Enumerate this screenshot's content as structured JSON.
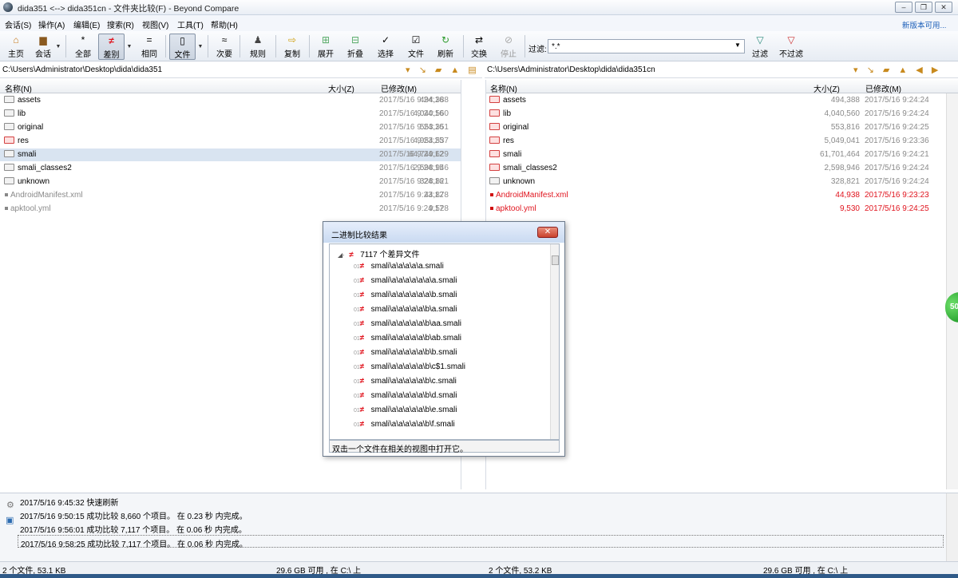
{
  "window": {
    "title": "dida351 <--> dida351cn - 文件夹比较(F) - Beyond Compare",
    "controls": [
      "–",
      "❐",
      "✕"
    ]
  },
  "menu": {
    "items": [
      "会话(S)",
      "操作(A)",
      "编辑(E)",
      "搜索(R)",
      "视图(V)",
      "工具(T)",
      "帮助(H)"
    ],
    "new_version": "新版本可用..."
  },
  "toolbar": {
    "home": "主页",
    "session": "会话",
    "all": "全部",
    "diffs": "差别",
    "same": "相同",
    "files": "文件",
    "minor": "次要",
    "rules": "规则",
    "copy": "复制",
    "expand": "展开",
    "collapse": "折叠",
    "select": "选择",
    "files2": "文件",
    "refresh": "刷新",
    "swap": "交换",
    "stop": "停止",
    "filter_label": "过滤:",
    "filter_value": "*.*",
    "filters": "过滤",
    "no_filters": "不过滤"
  },
  "left": {
    "path": "C:\\Users\\Administrator\\Desktop\\dida\\dida351",
    "headers": {
      "name": "名称(N)",
      "size": "大小(Z)",
      "modified": "已修改(M)"
    },
    "rows": [
      {
        "name": "assets",
        "size": "494,388",
        "date": "2017/5/16 9:24:16"
      },
      {
        "name": "lib",
        "size": "4,040,560",
        "date": "2017/5/16 9:24:16"
      },
      {
        "name": "original",
        "size": "553,351",
        "date": "2017/5/16 9:24:16"
      },
      {
        "name": "res",
        "size": "4,954,537",
        "date": "2017/5/16 9:23:25"
      },
      {
        "name": "smali",
        "size": "64,749,629",
        "date": "2017/5/16 9:24:12"
      },
      {
        "name": "smali_classes2",
        "size": "2,598,946",
        "date": "2017/5/16 9:24:15"
      },
      {
        "name": "unknown",
        "size": "328,821",
        "date": "2017/5/16 9:24:16"
      },
      {
        "name": "AndroidManifest.xml",
        "size": "44,878",
        "date": "2017/5/16 9:23:12"
      },
      {
        "name": "apktool.yml",
        "size": "9,528",
        "date": "2017/5/16 9:24:17"
      }
    ]
  },
  "right": {
    "path": "C:\\Users\\Administrator\\Desktop\\dida\\dida351cn",
    "headers": {
      "name": "名称(N)",
      "size": "大小(Z)",
      "modified": "已修改(M)"
    },
    "rows": [
      {
        "name": "assets",
        "size": "494,388",
        "date": "2017/5/16 9:24:24"
      },
      {
        "name": "lib",
        "size": "4,040,560",
        "date": "2017/5/16 9:24:24"
      },
      {
        "name": "original",
        "size": "553,816",
        "date": "2017/5/16 9:24:25"
      },
      {
        "name": "res",
        "size": "5,049,041",
        "date": "2017/5/16 9:23:36"
      },
      {
        "name": "smali",
        "size": "61,701,464",
        "date": "2017/5/16 9:24:21"
      },
      {
        "name": "smali_classes2",
        "size": "2,598,946",
        "date": "2017/5/16 9:24:24"
      },
      {
        "name": "unknown",
        "size": "328,821",
        "date": "2017/5/16 9:24:24"
      },
      {
        "name": "AndroidManifest.xml",
        "size": "44,938",
        "date": "2017/5/16 9:23:23"
      },
      {
        "name": "apktool.yml",
        "size": "9,530",
        "date": "2017/5/16 9:24:25"
      }
    ]
  },
  "dialog": {
    "title": "二进制比较结果",
    "root": "7117 个差异文件",
    "items": [
      "smali\\a\\a\\a\\a\\a.smali",
      "smali\\a\\a\\a\\a\\a\\a\\a.smali",
      "smali\\a\\a\\a\\a\\a\\a\\b.smali",
      "smali\\a\\a\\a\\a\\a\\b\\a.smali",
      "smali\\a\\a\\a\\a\\a\\b\\aa.smali",
      "smali\\a\\a\\a\\a\\a\\b\\ab.smali",
      "smali\\a\\a\\a\\a\\a\\b\\b.smali",
      "smali\\a\\a\\a\\a\\a\\b\\c$1.smali",
      "smali\\a\\a\\a\\a\\a\\b\\c.smali",
      "smali\\a\\a\\a\\a\\a\\b\\d.smali",
      "smali\\a\\a\\a\\a\\a\\b\\e.smali",
      "smali\\a\\a\\a\\a\\a\\b\\f.smali"
    ],
    "status": "双击一个文件在相关的视图中打开它。"
  },
  "log": [
    "2017/5/16 9:45:32  快速刷新",
    "2017/5/16 9:50:15  成功比较 8,660 个项目。  在 0.23 秒 内完成。",
    "2017/5/16 9:56:01  成功比较 7,117 个项目。  在 0.06 秒 内完成。",
    "2017/5/16 9:58:25  成功比较 7,117 个项目。  在 0.06 秒 内完成。"
  ],
  "status": {
    "left_files": "2 个文件, 53.1 KB",
    "left_space": "29.6 GB 可用 , 在 C:\\ 上",
    "right_files": "2 个文件, 53.2 KB",
    "right_space": "29.6 GB 可用 , 在 C:\\ 上"
  },
  "badge": "50"
}
